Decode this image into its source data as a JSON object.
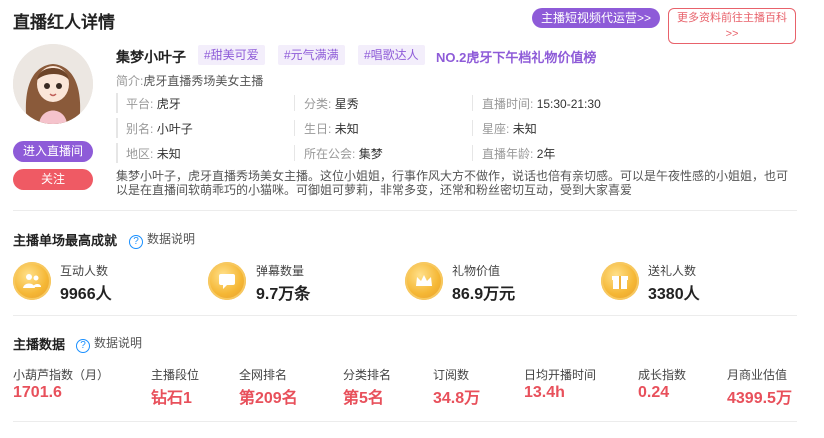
{
  "header": {
    "title": "直播红人详情",
    "promo_label": "主播短视频代运营>>",
    "wiki_label_line1": "更多资料前往主播百科",
    "wiki_label_line2": ">>"
  },
  "profile": {
    "name": "集梦小叶子",
    "tags": [
      "#甜美可爱",
      "#元气满满",
      "#唱歌达人"
    ],
    "rank": "NO.2虎牙下午档礼物价值榜",
    "intro_key": "简介:",
    "intro_value": "虎牙直播秀场美女主播",
    "enter_label": "进入直播间",
    "follow_label": "关注",
    "rows": [
      [
        {
          "k": "平台:",
          "v": "虎牙"
        },
        {
          "k": "分类:",
          "v": "星秀"
        },
        {
          "k": "直播时间:",
          "v": "15:30-21:30"
        }
      ],
      [
        {
          "k": "别名:",
          "v": "小叶子"
        },
        {
          "k": "生日:",
          "v": "未知"
        },
        {
          "k": "星座:",
          "v": "未知"
        }
      ],
      [
        {
          "k": "地区:",
          "v": "未知"
        },
        {
          "k": "所在公会:",
          "v": "集梦"
        },
        {
          "k": "直播年龄:",
          "v": "2年"
        }
      ]
    ],
    "description": "集梦小叶子，虎牙直播秀场美女主播。这位小姐姐，行事作风大方不做作，说话也倍有亲切感。可以是午夜性感的小姐姐，也可以是在直播间软萌乖巧的小猫咪。可御姐可萝莉，非常多变，还常和粉丝密切互动，受到大家喜爱"
  },
  "best": {
    "title": "主播单场最高成就",
    "help": "数据说明",
    "stats": [
      {
        "label": "互动人数",
        "value": "9966人",
        "icon": "people-icon"
      },
      {
        "label": "弹幕数量",
        "value": "9.7万条",
        "icon": "chat-icon"
      },
      {
        "label": "礼物价值",
        "value": "86.9万元",
        "icon": "crown-icon"
      },
      {
        "label": "送礼人数",
        "value": "3380人",
        "icon": "gift-icon"
      }
    ]
  },
  "anchor_data": {
    "title": "主播数据",
    "help": "数据说明",
    "metrics": [
      {
        "label": "小葫芦指数（月）",
        "value": "1701.6"
      },
      {
        "label": "主播段位",
        "value": "钻石1"
      },
      {
        "label": "全网排名",
        "value": "第209名"
      },
      {
        "label": "分类排名",
        "value": "第5名"
      },
      {
        "label": "订阅数",
        "value": "34.8万"
      },
      {
        "label": "日均开播时间",
        "value": "13.4h"
      },
      {
        "label": "成长指数",
        "value": "0.24"
      },
      {
        "label": "月商业估值",
        "value": "4399.5万"
      }
    ]
  }
}
